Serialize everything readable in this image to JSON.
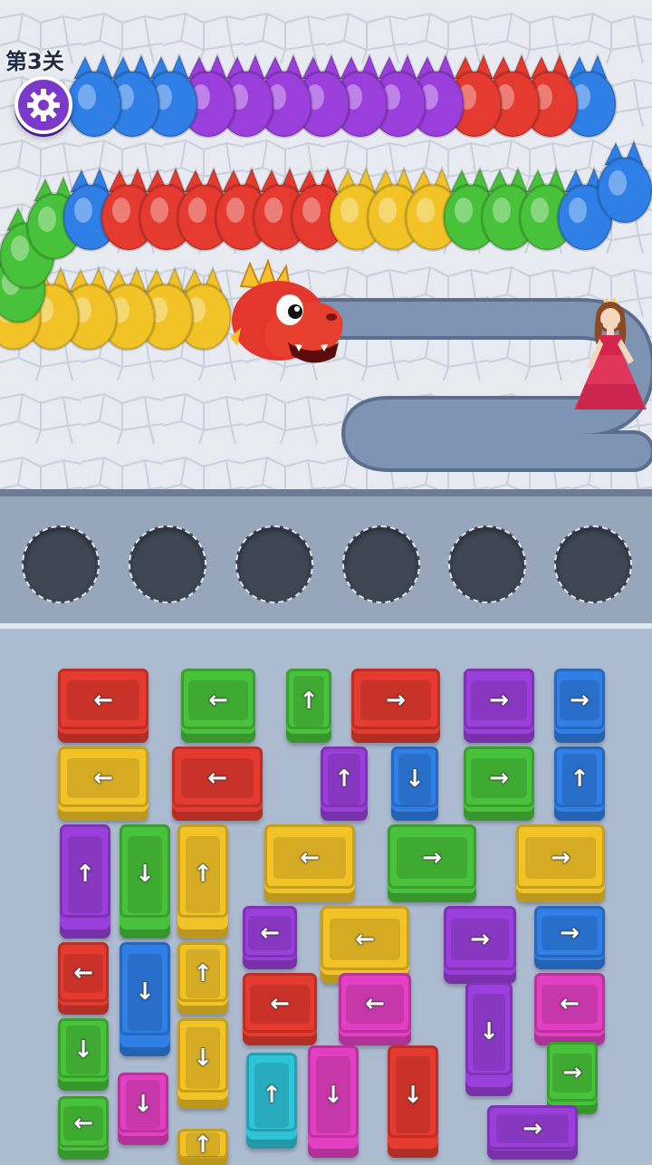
{
  "level": {
    "label": "第3关"
  },
  "colors": {
    "red": "#e43a2f",
    "green": "#47c23a",
    "yellow": "#f2c327",
    "purple": "#9b3fdc",
    "blue": "#2f7fe6",
    "pink": "#e23fc2",
    "cyan": "#2ec4d8",
    "slot_bg": "#3e4653",
    "track": "#6e84a6",
    "settings_button": "#7b39c9"
  },
  "icons": {
    "settings": "gear-icon",
    "dragon": "dragon-head-icon",
    "princess": "princess-icon"
  },
  "slots": {
    "count": 6,
    "filled": 0
  },
  "dragon_body_colors": [
    "yellow",
    "yellow",
    "yellow",
    "yellow",
    "yellow",
    "yellow",
    "green",
    "green",
    "green",
    "blue",
    "red",
    "red",
    "red",
    "red",
    "red",
    "red",
    "yellow",
    "yellow",
    "yellow",
    "green",
    "green",
    "green",
    "blue",
    "blue",
    "blue",
    "red",
    "red",
    "red",
    "purple",
    "purple",
    "purple",
    "purple",
    "purple",
    "purple",
    "purple",
    "blue",
    "blue",
    "blue",
    "blue"
  ],
  "boxes": [
    {
      "color": "red",
      "dir": "left"
    },
    {
      "color": "green",
      "dir": "left"
    },
    {
      "color": "green",
      "dir": "up"
    },
    {
      "color": "red",
      "dir": "right"
    },
    {
      "color": "purple",
      "dir": "right"
    },
    {
      "color": "blue",
      "dir": "right"
    },
    {
      "color": "yellow",
      "dir": "left"
    },
    {
      "color": "red",
      "dir": "left"
    },
    {
      "color": "purple",
      "dir": "up"
    },
    {
      "color": "blue",
      "dir": "down"
    },
    {
      "color": "green",
      "dir": "right"
    },
    {
      "color": "blue",
      "dir": "up"
    },
    {
      "color": "purple",
      "dir": "up"
    },
    {
      "color": "green",
      "dir": "down"
    },
    {
      "color": "yellow",
      "dir": "up"
    },
    {
      "color": "yellow",
      "dir": "left"
    },
    {
      "color": "green",
      "dir": "right"
    },
    {
      "color": "yellow",
      "dir": "right"
    },
    {
      "color": "purple",
      "dir": "left"
    },
    {
      "color": "yellow",
      "dir": "left"
    },
    {
      "color": "purple",
      "dir": "right"
    },
    {
      "color": "blue",
      "dir": "right"
    },
    {
      "color": "red",
      "dir": "left"
    },
    {
      "color": "blue",
      "dir": "down"
    },
    {
      "color": "yellow",
      "dir": "up"
    },
    {
      "color": "red",
      "dir": "left"
    },
    {
      "color": "pink",
      "dir": "left"
    },
    {
      "color": "purple",
      "dir": "down"
    },
    {
      "color": "pink",
      "dir": "left"
    },
    {
      "color": "green",
      "dir": "down"
    },
    {
      "color": "yellow",
      "dir": "down"
    },
    {
      "color": "green",
      "dir": "right"
    },
    {
      "color": "pink",
      "dir": "down"
    },
    {
      "color": "cyan",
      "dir": "up"
    },
    {
      "color": "pink",
      "dir": "down"
    },
    {
      "color": "red",
      "dir": "down"
    },
    {
      "color": "green",
      "dir": "left"
    },
    {
      "color": "yellow",
      "dir": "up"
    },
    {
      "color": "purple",
      "dir": "right"
    }
  ]
}
